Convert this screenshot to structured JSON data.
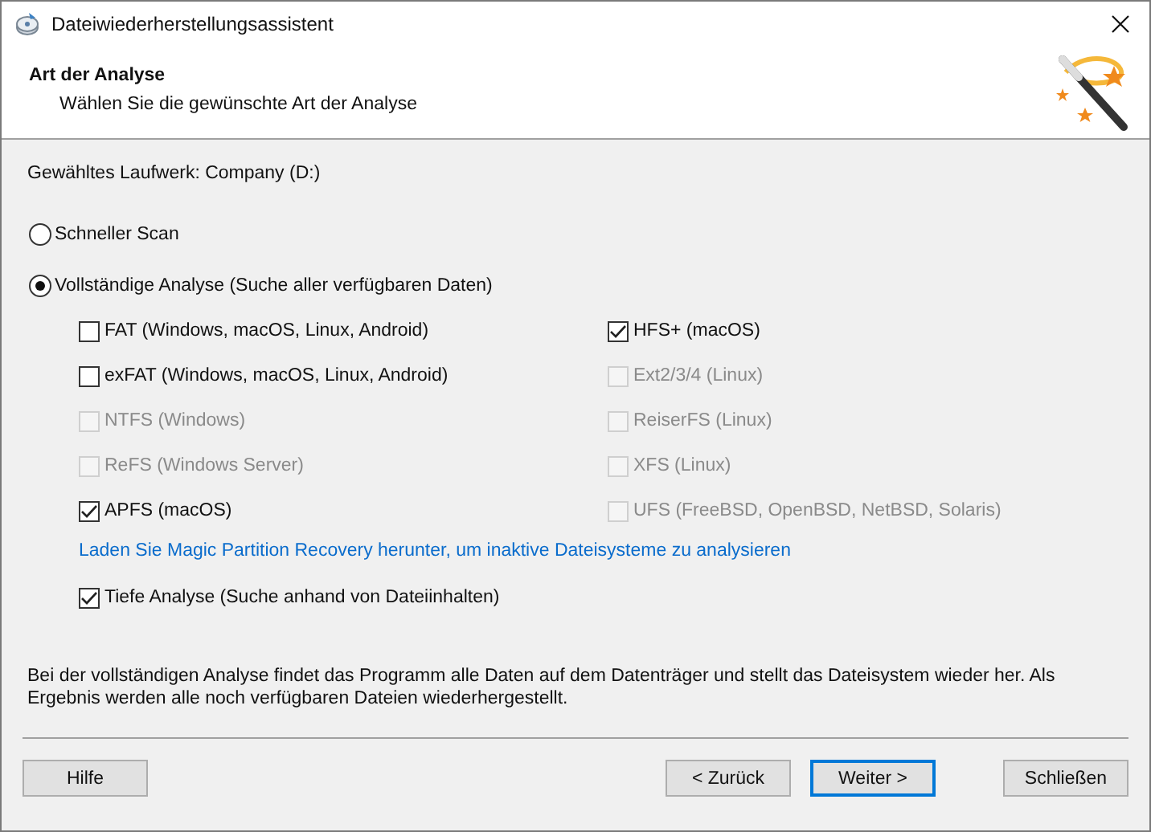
{
  "window": {
    "title": "Dateiwiederherstellungsassistent"
  },
  "header": {
    "title": "Art der Analyse",
    "subtitle": "Wählen Sie die gewünschte Art der Analyse"
  },
  "drive_label": "Gewähltes Laufwerk: Company (D:)",
  "scan_options": [
    {
      "label": "Schneller Scan",
      "selected": false
    },
    {
      "label": "Vollständige Analyse (Suche aller verfügbaren Daten)",
      "selected": true
    }
  ],
  "filesystems": [
    {
      "label": "FAT (Windows, macOS, Linux, Android)",
      "checked": false,
      "disabled": false
    },
    {
      "label": "HFS+ (macOS)",
      "checked": true,
      "disabled": false
    },
    {
      "label": "exFAT (Windows, macOS, Linux, Android)",
      "checked": false,
      "disabled": false
    },
    {
      "label": "Ext2/3/4 (Linux)",
      "checked": false,
      "disabled": true
    },
    {
      "label": "NTFS (Windows)",
      "checked": false,
      "disabled": true
    },
    {
      "label": "ReiserFS (Linux)",
      "checked": false,
      "disabled": true
    },
    {
      "label": "ReFS (Windows Server)",
      "checked": false,
      "disabled": true
    },
    {
      "label": "XFS (Linux)",
      "checked": false,
      "disabled": true
    },
    {
      "label": "APFS (macOS)",
      "checked": true,
      "disabled": false
    },
    {
      "label": "UFS (FreeBSD, OpenBSD, NetBSD, Solaris)",
      "checked": false,
      "disabled": true
    }
  ],
  "download_link": "Laden Sie Magic Partition Recovery herunter, um inaktive Dateisysteme zu analysieren",
  "deep_analysis": {
    "label": "Tiefe Analyse (Suche anhand von Dateiinhalten)",
    "checked": true
  },
  "description": "Bei der vollständigen Analyse findet das Programm alle Daten auf dem Datenträger und stellt das Dateisystem wieder her. Als Ergebnis werden alle noch verfügbaren Dateien wiederhergestellt.",
  "buttons": [
    {
      "label": "Hilfe",
      "focused": false
    },
    {
      "label": "< Zurück",
      "focused": false
    },
    {
      "label": "Weiter >",
      "focused": true
    },
    {
      "label": "Schließen",
      "focused": false
    }
  ]
}
